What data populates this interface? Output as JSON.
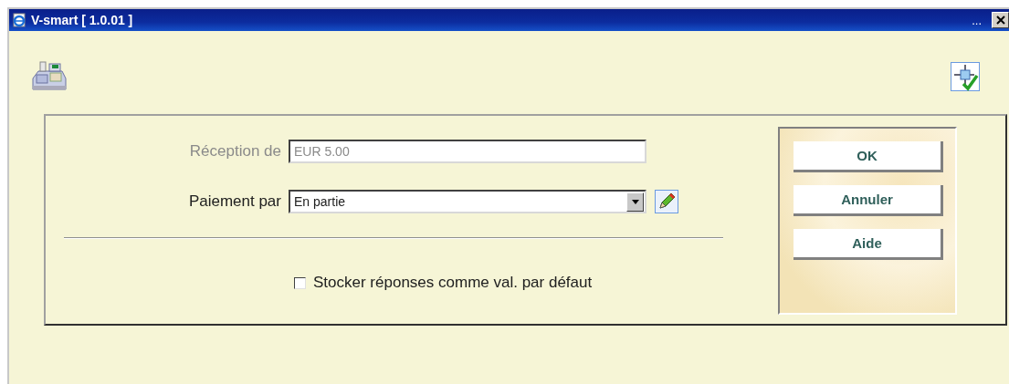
{
  "window": {
    "title": "V-smart [ 1.0.01 ]",
    "menu_dots": "..."
  },
  "form": {
    "fields": [
      {
        "kind": "text",
        "label": "Réception de",
        "value": "EUR 5.00",
        "disabled": true
      },
      {
        "kind": "select",
        "label": "Paiement par",
        "value": "En partie",
        "disabled": false
      }
    ],
    "store_defaults": {
      "label": "Stocker réponses comme val. par défaut",
      "checked": false
    }
  },
  "buttons": [
    "OK",
    "Annuler",
    "Aide"
  ]
}
